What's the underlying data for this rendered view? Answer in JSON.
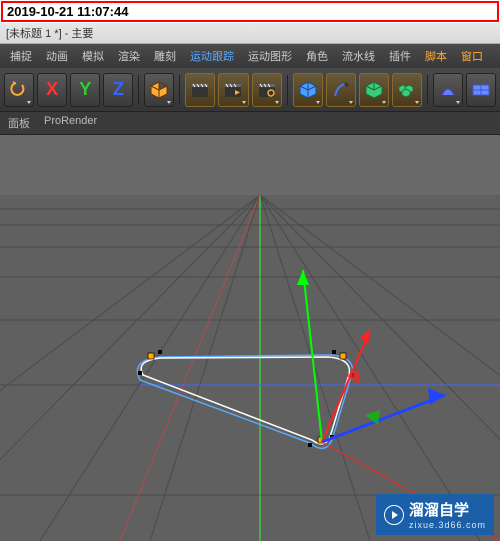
{
  "timestamp": "2019-10-21 11:07:44",
  "window_title": "[未标题 1 *] - 主要",
  "menu": {
    "capture": "捕捉",
    "animate": "动画",
    "simulate": "模拟",
    "render": "渲染",
    "sculpt": "雕刻",
    "motion_track": "运动跟踪",
    "motion_graphics": "运动图形",
    "character": "角色",
    "hair": "流水线",
    "plugins": "插件",
    "script": "脚本",
    "window": "窗口"
  },
  "panel_bar": {
    "panel": "面板",
    "prorender": "ProRender"
  },
  "tools": {
    "xyz_reset": "reset-icon",
    "x_axis": "X",
    "y_axis": "Y",
    "z_axis": "Z",
    "cube": "cube-tool",
    "clap1": "render-tool-1",
    "clap2": "render-tool-2",
    "clap3": "render-tool-3",
    "prim_cube": "primitive-cube",
    "pen": "pen-tool",
    "deform": "deform-tool",
    "array": "array-tool",
    "bend": "bend-tool",
    "grid": "grid-tool"
  },
  "watermark": {
    "title": "溜溜自学",
    "sub": "zixue.3d66.com"
  }
}
